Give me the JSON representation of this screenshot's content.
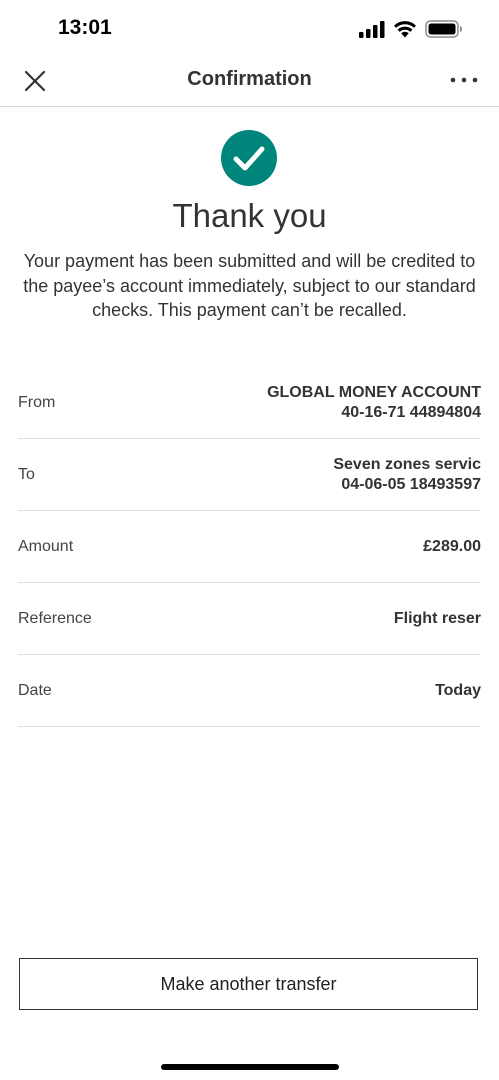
{
  "status_bar": {
    "time": "13:01",
    "icons": [
      "cellular-signal-icon",
      "wifi-icon",
      "battery-icon"
    ]
  },
  "header": {
    "title": "Confirmation",
    "close_icon": "close-icon",
    "more_icon": "more-options-icon"
  },
  "success": {
    "icon": "checkmark-icon",
    "icon_color": "#00857c",
    "title": "Thank you",
    "message": "Your payment has been submitted and will be credited to the payee’s account immediately, subject to our standard checks. This payment can’t be recalled."
  },
  "details": {
    "from": {
      "label": "From",
      "account_name": "GLOBAL MONEY ACCOUNT",
      "account_number": "40-16-71 44894804"
    },
    "to": {
      "label": "To",
      "payee_name": "Seven zones servic",
      "account_number": "04-06-05 18493597"
    },
    "amount": {
      "label": "Amount",
      "value": "£289.00"
    },
    "reference": {
      "label": "Reference",
      "value": "Flight reser"
    },
    "date": {
      "label": "Date",
      "value": "Today"
    }
  },
  "actions": {
    "make_another_transfer": "Make another transfer"
  }
}
